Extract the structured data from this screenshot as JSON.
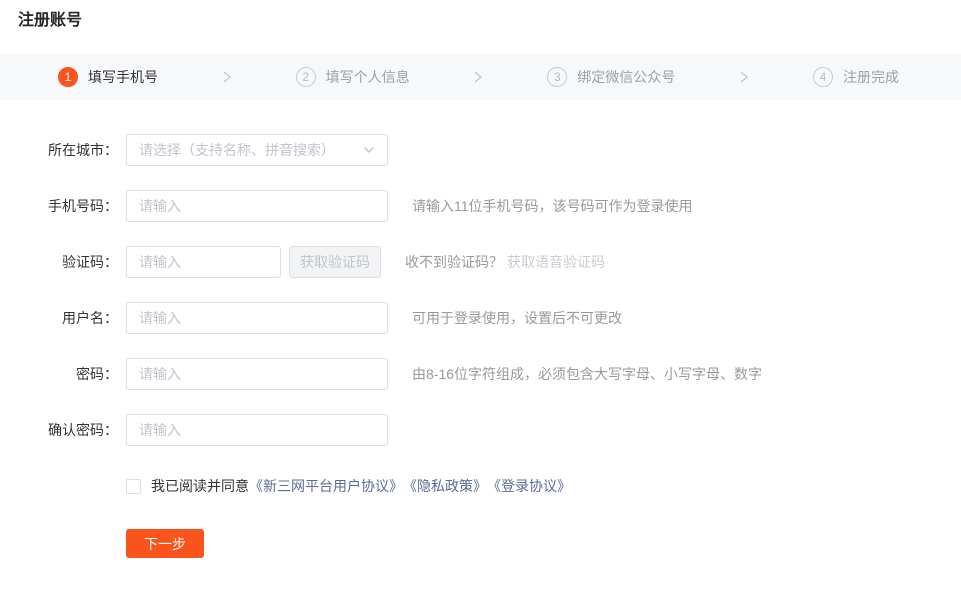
{
  "page": {
    "title": "注册账号"
  },
  "colors": {
    "accent": "#fa541c",
    "link": "#5a6b95",
    "steps_bar_bg": "#f7f8fa"
  },
  "steps": {
    "items": [
      {
        "number": "1",
        "label": "填写手机号",
        "active": true
      },
      {
        "number": "2",
        "label": "填写个人信息",
        "active": false
      },
      {
        "number": "3",
        "label": "绑定微信公众号",
        "active": false
      },
      {
        "number": "4",
        "label": "注册完成",
        "active": false
      }
    ]
  },
  "form": {
    "city": {
      "label": "所在城市：",
      "placeholder": "请选择（支持名称、拼音搜索）"
    },
    "phone": {
      "label": "手机号码：",
      "placeholder": "请输入",
      "value": "",
      "hint": "请输入11位手机号码，该号码可作为登录使用"
    },
    "code": {
      "label": "验证码：",
      "placeholder": "请输入",
      "value": "",
      "button_label": "获取验证码",
      "hint": "收不到验证码？",
      "voice_link": "获取语音验证码"
    },
    "username": {
      "label": "用户名：",
      "placeholder": "请输入",
      "value": "",
      "hint": "可用于登录使用，设置后不可更改"
    },
    "password": {
      "label": "密码：",
      "placeholder": "请输入",
      "value": "",
      "hint": "由8-16位字符组成，必须包含大写字母、小写字母、数字"
    },
    "confirm_password": {
      "label": "确认密码：",
      "placeholder": "请输入",
      "value": ""
    },
    "agreement": {
      "checked": false,
      "prefix": "我已阅读并同意",
      "links": [
        "《新三网平台用户协议》",
        "《隐私政策》",
        "《登录协议》"
      ]
    },
    "submit_label": "下一步"
  }
}
